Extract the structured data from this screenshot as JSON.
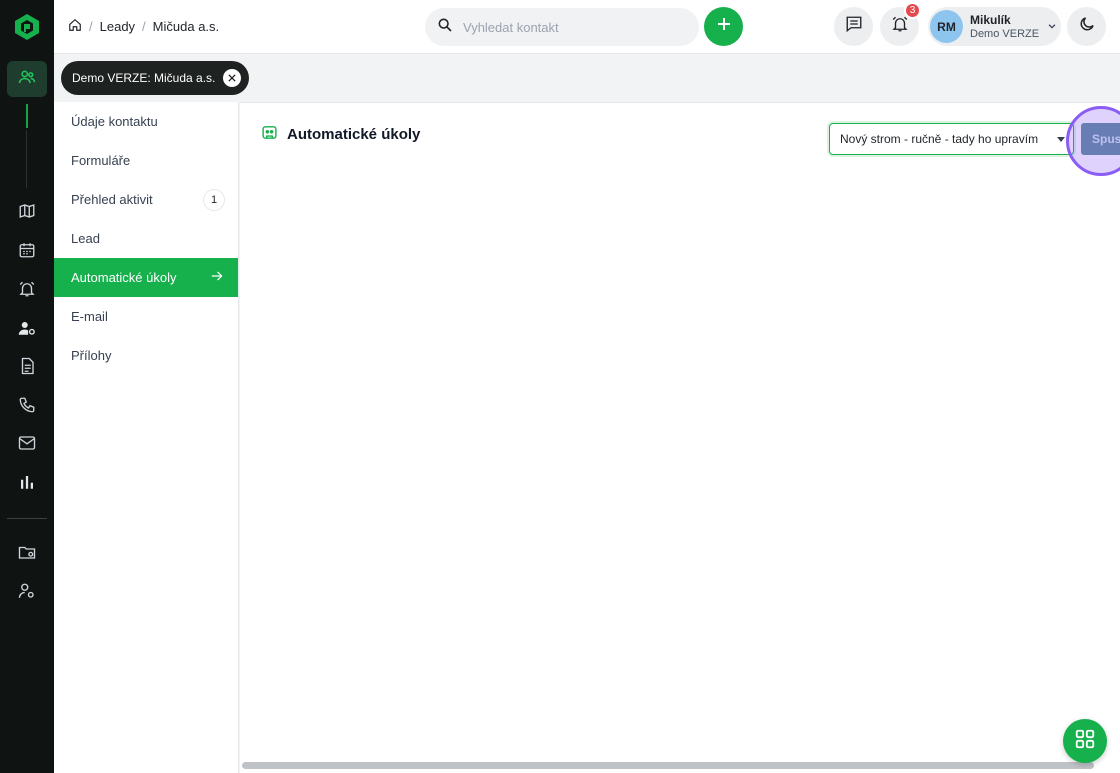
{
  "rail": {
    "items": [
      "contacts-icon",
      "map-icon",
      "calendar-icon",
      "alarm-icon",
      "user-settings-icon",
      "document-icon",
      "phone-icon",
      "mail-icon",
      "chart-icon",
      "folder-settings-icon",
      "user-cog-icon"
    ]
  },
  "breadcrumb": {
    "items": [
      "Leady",
      "Mičuda a.s."
    ]
  },
  "search": {
    "placeholder": "Vyhledat kontakt",
    "value": ""
  },
  "notifications": {
    "count": "3"
  },
  "user": {
    "initials": "RM",
    "name": "Mikulík",
    "org": "Demo VERZE"
  },
  "context_tab": {
    "label": "Demo VERZE: Mičuda a.s."
  },
  "subnav": {
    "items": [
      {
        "label": "Údaje kontaktu"
      },
      {
        "label": "Formuláře"
      },
      {
        "label": "Přehled aktivit",
        "count": "1"
      },
      {
        "label": "Lead"
      },
      {
        "label": "Automatické úkoly",
        "active": true
      },
      {
        "label": "E-mail"
      },
      {
        "label": "Přílohy"
      }
    ]
  },
  "main": {
    "title": "Automatické úkoly",
    "tree_select_value": "Nový strom - ručně - tady ho upravím",
    "run_button_label": "Spus"
  },
  "colors": {
    "accent": "#16b04c",
    "rail_bg": "#0f1413",
    "highlight": "#8b5cf6",
    "badge": "#e5484d"
  }
}
